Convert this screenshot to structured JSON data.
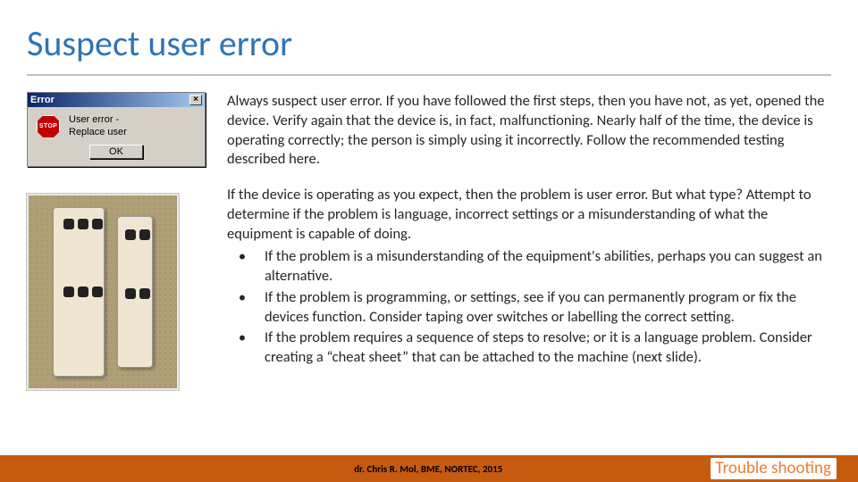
{
  "title": "Suspect user error",
  "error_dialog": {
    "title": "Error",
    "stop": "STOP",
    "message_line1": "User error -",
    "message_line2": "Replace user",
    "ok": "OK"
  },
  "paragraph1": "Always suspect user error. If you have followed the first steps, then you have not, as yet, opened the device. Verify again that the device is, in fact, malfunctioning. Nearly half of the time, the device is operating correctly; the person is simply using it incorrectly. Follow the recommended testing described here.",
  "paragraph2_lead": "If the device is operating as you expect, then the problem is user error. But what type? Attempt to determine if the problem is language, incorrect settings or a misunderstanding of what the equipment is capable of doing.",
  "bullets": [
    "If the problem is a misunderstanding of the equipment's abilities, perhaps you can suggest an alternative.",
    "If the problem is programming, or settings, see if you can permanently program or fix the devices function. Consider taping over switches or labelling the correct setting.",
    "If the problem requires a sequence of steps to resolve; or it is a language problem. Consider creating a “cheat sheet” that can be attached to the machine (next slide)."
  ],
  "footer": {
    "attribution": "dr. Chris R. Mol, BME, NORTEC, 2015",
    "section": "Trouble shooting"
  }
}
